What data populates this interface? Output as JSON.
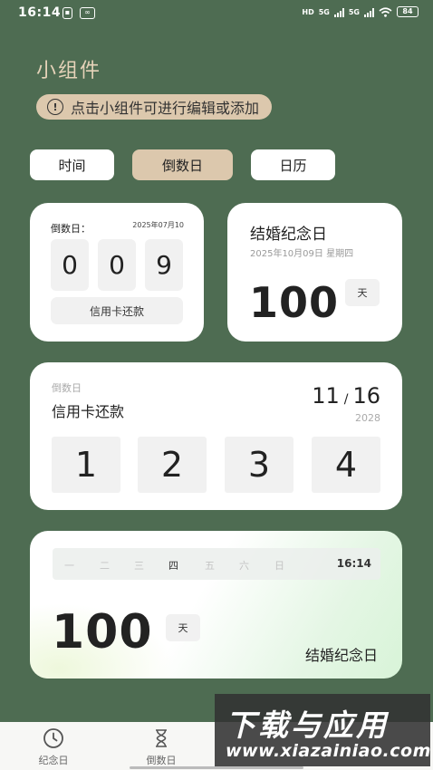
{
  "status_bar": {
    "time": "16:14",
    "right_indicators": [
      "HD",
      "5G",
      "5G"
    ],
    "battery": "84",
    "icons": [
      "sim-card-icon",
      "infinity-icon",
      "signal-icon",
      "wifi-icon",
      "battery-icon"
    ]
  },
  "page_title": "小组件",
  "hint": {
    "icon": "info-circle-icon",
    "text": "点击小组件可进行编辑或添加"
  },
  "tabs": [
    {
      "label": "时间",
      "active": false
    },
    {
      "label": "倒数日",
      "active": true
    },
    {
      "label": "日历",
      "active": false
    }
  ],
  "widgets": {
    "countdown_small": {
      "label": "倒数日：",
      "date": "2025年07月10",
      "digits": [
        "0",
        "0",
        "9"
      ],
      "name": "信用卡还款"
    },
    "anniversary_small": {
      "title": "结婚纪念日",
      "date": "2025年10月09日 星期四",
      "days": "100",
      "unit": "天"
    },
    "countdown_wide": {
      "label": "倒数日",
      "name": "信用卡还款",
      "month": "11",
      "day": "16",
      "year": "2028",
      "digits": [
        "1",
        "2",
        "3",
        "4"
      ]
    },
    "anniversary_wide": {
      "weekdays": [
        "一",
        "二",
        "三",
        "四",
        "五",
        "六",
        "日"
      ],
      "today_index": 3,
      "time": "16:14",
      "days": "100",
      "unit": "天",
      "name": "结婚纪念日"
    }
  },
  "bottom_nav": [
    {
      "label": "纪念日",
      "icon": "clock-icon"
    },
    {
      "label": "倒数日",
      "icon": "hourglass-icon"
    }
  ],
  "watermark": {
    "title": "下载与应用",
    "url": "www.xiazainiao.com"
  },
  "colors": {
    "background": "#4e6c52",
    "accent": "#dcc8ad",
    "title": "#e6d3b9",
    "card": "#ffffff"
  }
}
